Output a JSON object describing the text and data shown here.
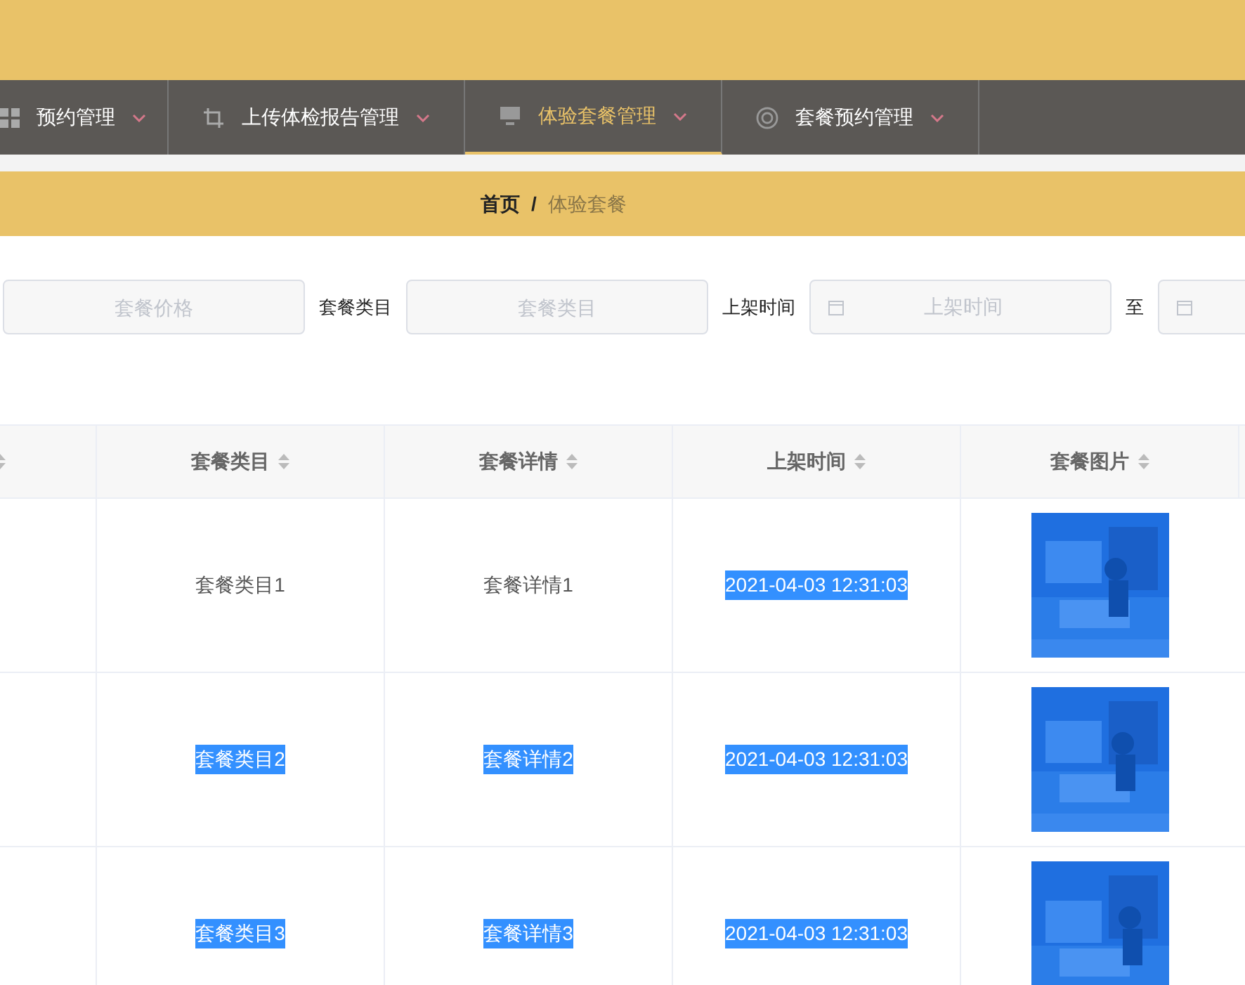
{
  "nav": {
    "items": [
      {
        "label": "预约管理",
        "selected": false
      },
      {
        "label": "上传体检报告管理",
        "selected": false
      },
      {
        "label": "体验套餐管理",
        "selected": true
      },
      {
        "label": "套餐预约管理",
        "selected": false
      }
    ]
  },
  "breadcrumb": {
    "home": "首页",
    "separator": "/",
    "current": "体验套餐"
  },
  "search": [
    {
      "kind": "field",
      "placeholder": "套餐价格"
    },
    {
      "kind": "label",
      "text": "套餐类目"
    },
    {
      "kind": "field",
      "placeholder": "套餐类目"
    },
    {
      "kind": "label",
      "text": "上架时间"
    },
    {
      "kind": "date",
      "placeholder": "上架时间"
    },
    {
      "kind": "label",
      "text": "至"
    },
    {
      "kind": "date"
    }
  ],
  "table": {
    "columns": [
      "套餐类目",
      "套餐详情",
      "上架时间",
      "套餐图片"
    ],
    "rows": [
      {
        "cells": [
          {
            "text": "套餐类目1",
            "highlighted": false
          },
          {
            "text": "套餐详情1",
            "highlighted": false
          },
          {
            "text": "2021-04-03 12:31:03",
            "highlighted": true
          }
        ],
        "image": {
          "kind": "picture"
        }
      },
      {
        "cells": [
          {
            "text": "套餐类目2",
            "highlighted": true
          },
          {
            "text": "套餐详情2",
            "highlighted": true
          },
          {
            "text": "2021-04-03 12:31:03",
            "highlighted": true
          }
        ],
        "image": {
          "kind": "picture"
        }
      },
      {
        "cells": [
          {
            "text": "套餐类目3",
            "highlighted": true
          },
          {
            "text": "套餐详情3",
            "highlighted": true
          },
          {
            "text": "2021-04-03 12:31:03",
            "highlighted": true
          }
        ],
        "image": {
          "kind": "picture"
        }
      }
    ]
  }
}
